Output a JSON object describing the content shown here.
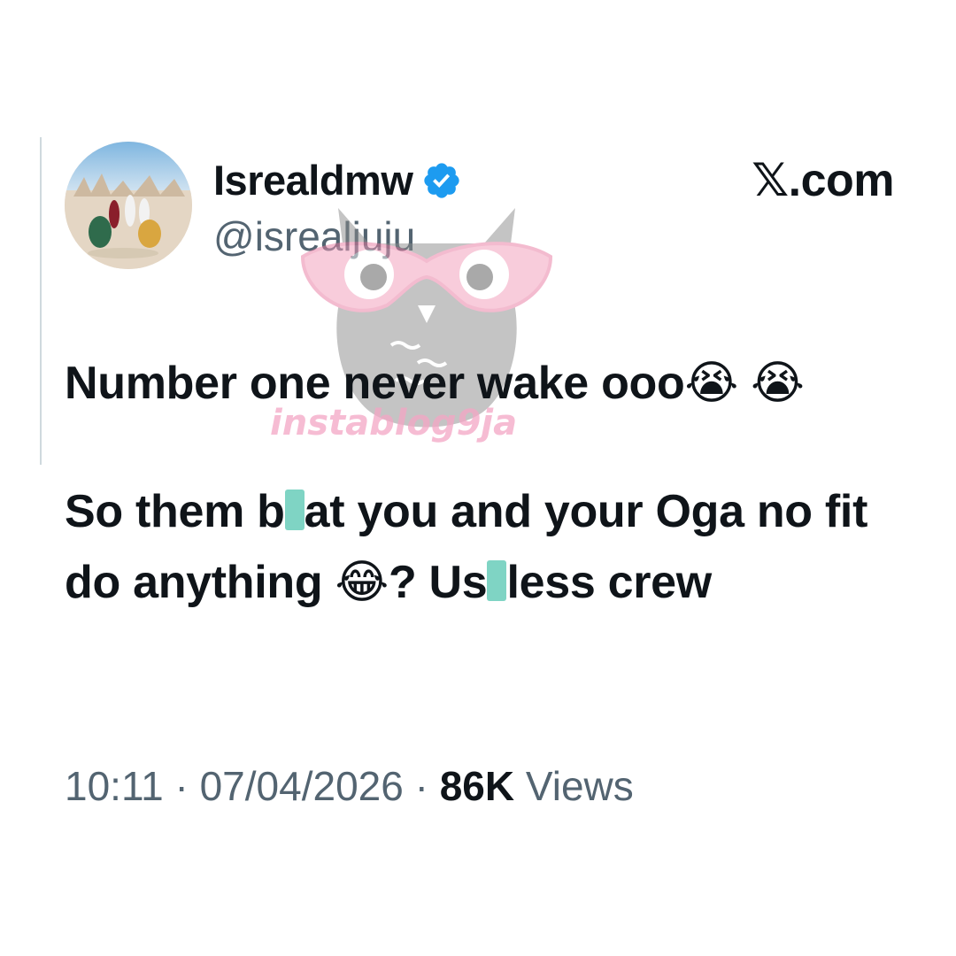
{
  "tweet": {
    "display_name": "Isrealdmw",
    "handle": "@isrealjuju",
    "verified": true,
    "brand": "𝕏.com",
    "body": {
      "line1": "Number one never wake ooo😭 😭",
      "line2_part1": "So them b",
      "line2_part2": "at you and your Oga no fit do anything 😂? Us",
      "line2_part3": "less crew"
    },
    "time": "10:11",
    "separator": "·",
    "date": "07/04/2026",
    "views_count": "86K",
    "views_label": "Views"
  },
  "watermark": {
    "text": "instablog9ja"
  },
  "colors": {
    "text": "#0f1419",
    "secondary": "#536471",
    "verified": "#1d9bf0",
    "censor": "#7fd4c4",
    "watermark": "#f4a6c5"
  }
}
